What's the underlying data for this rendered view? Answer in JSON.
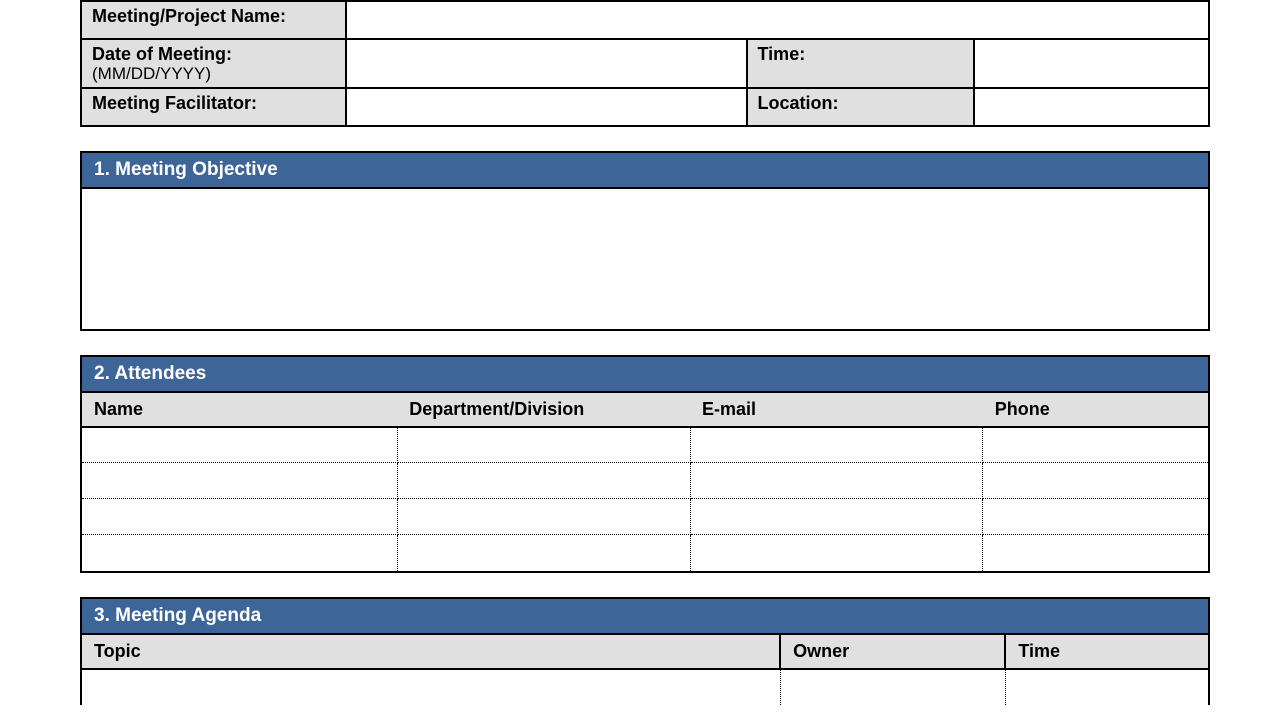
{
  "header": {
    "meeting_name_label": "Meeting/Project Name:",
    "meeting_name_value": "",
    "date_label": "Date of Meeting:",
    "date_sub": "(MM/DD/YYYY)",
    "date_value": "",
    "time_label": "Time:",
    "time_value": "",
    "facilitator_label": "Meeting Facilitator:",
    "facilitator_value": "",
    "location_label": "Location:",
    "location_value": ""
  },
  "sections": {
    "objective": {
      "title": "1. Meeting Objective",
      "body": ""
    },
    "attendees": {
      "title": "2. Attendees",
      "columns": {
        "name": "Name",
        "dept": "Department/Division",
        "email": "E-mail",
        "phone": "Phone"
      },
      "rows": [
        {
          "name": "",
          "dept": "",
          "email": "",
          "phone": ""
        },
        {
          "name": "",
          "dept": "",
          "email": "",
          "phone": ""
        },
        {
          "name": "",
          "dept": "",
          "email": "",
          "phone": ""
        },
        {
          "name": "",
          "dept": "",
          "email": "",
          "phone": ""
        }
      ]
    },
    "agenda": {
      "title": "3. Meeting Agenda",
      "columns": {
        "topic": "Topic",
        "owner": "Owner",
        "time": "Time"
      },
      "rows": [
        {
          "topic": "",
          "owner": "",
          "time": ""
        }
      ]
    }
  }
}
